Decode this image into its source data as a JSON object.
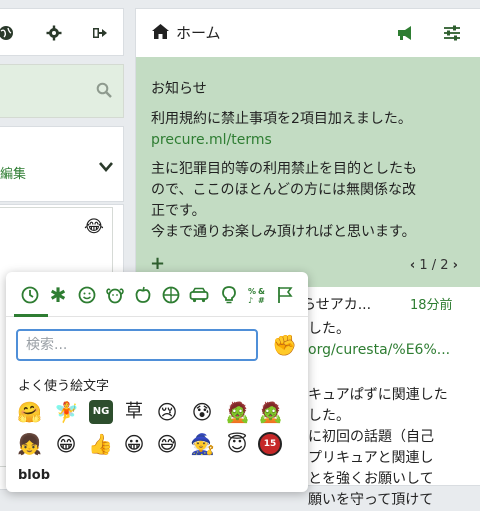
{
  "left": {
    "section_label": "編集"
  },
  "home": {
    "title": "ホーム",
    "announcement": {
      "heading": "お知らせ",
      "line1": "利用規約に禁止事項を2項目加えました。",
      "link": "precure.ml/terms",
      "body1": "主に犯罪目的等の利用禁止を目的としたも",
      "body2": "ので、ここのほとんどの方には無関係な改",
      "body3": "正です。",
      "body4": "今まで通りお楽しみ頂ければと思います。",
      "pager": "1 / 2"
    },
    "timeline": {
      "line1": "お知らせアカ...",
      "time": "18分前",
      "line2": "した。",
      "link": "org/curesta/%E6%...",
      "line3": "キュアぱずに関連した",
      "line4": "した。",
      "line5": "に初回の話題（自己",
      "line6": "プリキュアと関連し",
      "line7": "とを強くお願いして",
      "line8": "願いを守って頂けて"
    }
  },
  "emoji_picker": {
    "search_placeholder": "検索...",
    "frequent_label": "よく使う絵文字",
    "custom_label": "blob",
    "text_emoji_kusa": "草",
    "text_emoji_15": "15",
    "text_emoji_ng": "NG",
    "categories": [
      "recent",
      "custom",
      "people",
      "nature",
      "food",
      "activity",
      "travel",
      "objects",
      "symbols",
      "flags"
    ]
  },
  "colors": {
    "accent_green": "#2e7d32",
    "announcement_bg": "#c3dcc3",
    "search_border": "#4f8fd8"
  }
}
